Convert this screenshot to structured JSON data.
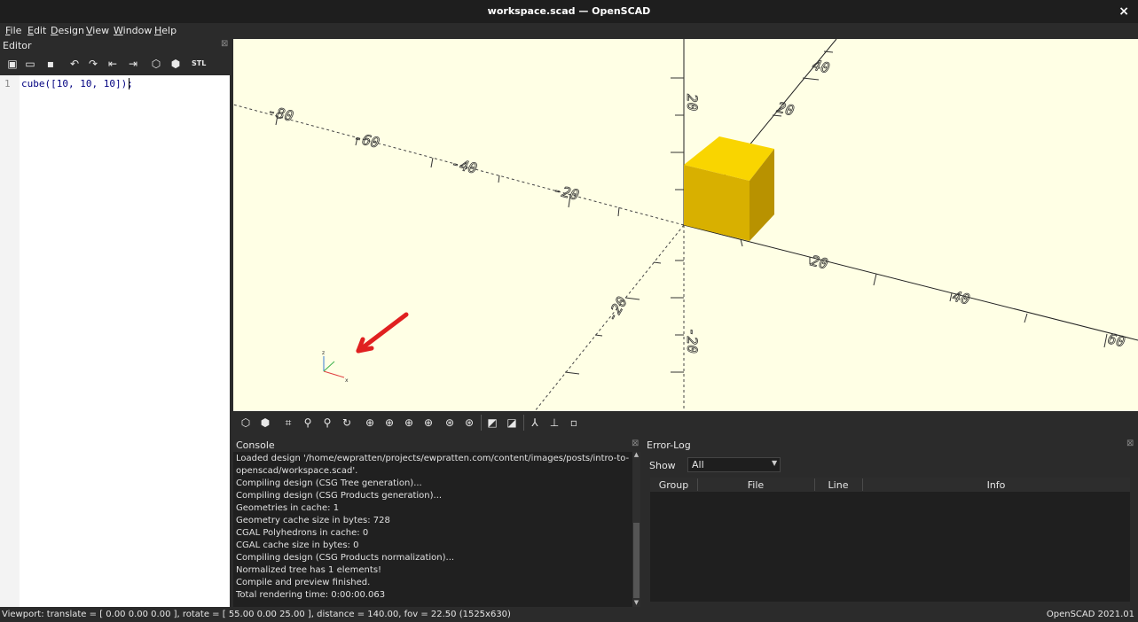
{
  "window": {
    "title": "workspace.scad — OpenSCAD",
    "close": "×"
  },
  "menu": [
    "File",
    "Edit",
    "Design",
    "View",
    "Window",
    "Help"
  ],
  "editor": {
    "label": "Editor",
    "dock_close": "⊠",
    "line_number": "1",
    "code": "cube([10, 10, 10]);",
    "toolbar_icons": [
      "new-icon",
      "open-icon",
      "save-icon",
      "undo-icon",
      "redo-icon",
      "unindent-icon",
      "indent-icon",
      "preview-icon",
      "render-icon",
      "export-stl-icon"
    ]
  },
  "viewport": {
    "background": "#ffffe5",
    "cube_colors": {
      "top": "#f9d500",
      "front": "#d8b000",
      "side": "#b89200"
    },
    "arrow_color": "#e02020",
    "axis_labels": {
      "x_pos": [
        "20",
        "40",
        "60"
      ],
      "x_neg": [
        "-20",
        "-40",
        "-60",
        "-80"
      ],
      "y_pos": [
        "20",
        "40"
      ],
      "y_neg": [
        "-20"
      ],
      "z_pos": [
        "20"
      ],
      "z_neg": [
        "-20"
      ]
    },
    "gizmo": {
      "x": "x",
      "z": "z"
    }
  },
  "view_toolbar": [
    "preview-icon",
    "render-icon",
    "view-all-icon",
    "zoom-in-icon",
    "zoom-out-icon",
    "reset-view-icon",
    "right-view-icon",
    "top-view-icon",
    "bottom-view-icon",
    "left-view-icon",
    "front-view-icon",
    "back-view-icon",
    "perspective-icon",
    "orthogonal-icon",
    "show-axes-icon",
    "show-scale-icon",
    "show-edges-icon"
  ],
  "console": {
    "label": "Console",
    "close": "⊠",
    "lines": [
      "Loaded design '/home/ewpratten/projects/ewpratten.com/content/images/posts/intro-to-",
      "openscad/workspace.scad'.",
      "Compiling design (CSG Tree generation)...",
      "Compiling design (CSG Products generation)...",
      "Geometries in cache: 1",
      "Geometry cache size in bytes: 728",
      "CGAL Polyhedrons in cache: 0",
      "CGAL cache size in bytes: 0",
      "Compiling design (CSG Products normalization)...",
      "Normalized tree has 1 elements!",
      "Compile and preview finished.",
      "Total rendering time: 0:00:00.063"
    ]
  },
  "error_log": {
    "label": "Error-Log",
    "close": "⊠",
    "show_label": "Show",
    "show_value": "All",
    "columns": [
      "Group",
      "File",
      "Line",
      "Info"
    ]
  },
  "status": {
    "left": "Viewport: translate = [ 0.00 0.00 0.00 ], rotate = [ 55.00 0.00 25.00 ], distance = 140.00, fov = 22.50 (1525x630)",
    "right": "OpenSCAD 2021.01"
  }
}
